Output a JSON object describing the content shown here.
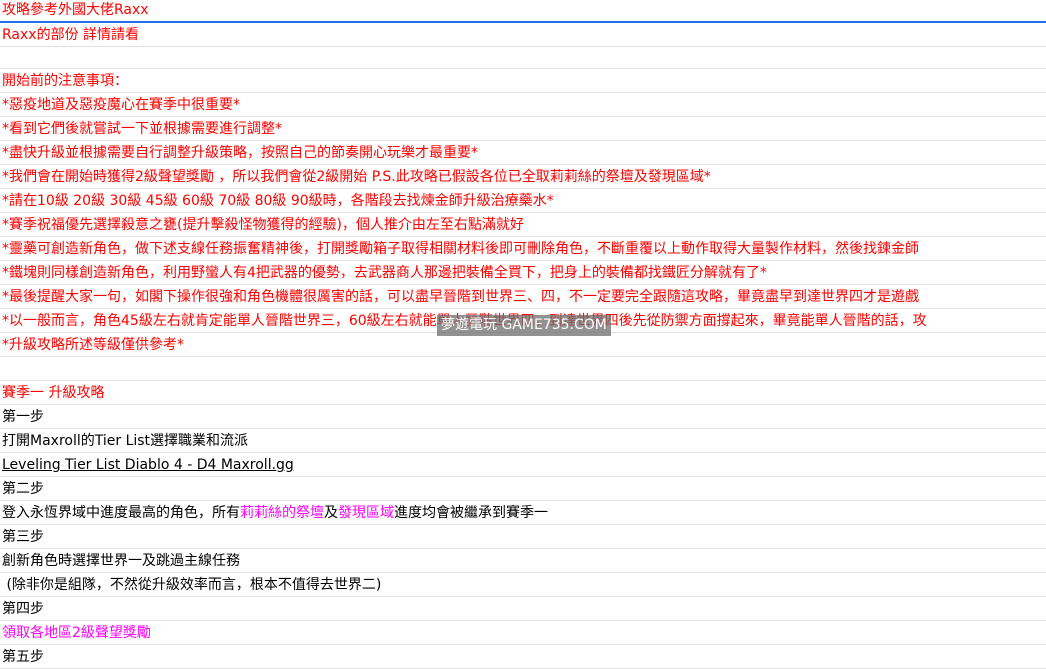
{
  "title": "攻略參考外國大佬Raxx",
  "intro": "Raxx的部份 詳情請看",
  "notes_heading": "開始前的注意事項：",
  "notes": [
    "*惡疫地道及惡疫魔心在賽季中很重要*",
    "*看到它們後就嘗試一下並根據需要進行調整*",
    "*盡快升級並根據需要自行調整升級策略，按照自己的節奏開心玩樂才最重要*",
    "*我們會在開始時獲得2級聲望獎勵 ，所以我們會從2級開始 P.S.此攻略已假設各位已全取莉莉絲的祭壇及發現區域*",
    "*請在10級 20級 30級 45級 60級 70級 80級 90級時，各階段去找煉金師升級治療藥水*",
    "*賽季祝福優先選擇殺意之甕(提升擊殺怪物獲得的經驗)，個人推介由左至右點滿就好",
    "*靈藥可創造新角色，做下述支線任務振奮精神後，打開獎勵箱子取得相關材料後即可刪除角色，不斷重覆以上動作取得大量製作材料，然後找鍊金師",
    "*鐵塊則同樣創造新角色，利用野蠻人有4把武器的優勢，去武器商人那邊把裝備全買下，把身上的裝備都找鐵匠分解就有了*",
    "*最後提醒大家一句，如閣下操作很強和角色機體很厲害的話，可以盡早晉階到世界三、四，不一定要完全跟隨這攻略，畢竟盡早到達世界四才是遊戲",
    "*以一般而言，角色45級左右就肯定能單人晉階世界三，60級左右就能單人晉階世界四，到達世界四後先從防禦方面撐起來，畢竟能單人晉階的話，攻",
    "*升級攻略所述等級僅供參考*"
  ],
  "season_heading": "賽季一 升級攻略",
  "steps": {
    "step1": "第一步",
    "step1_text": "打開Maxroll的Tier List選擇職業和流派",
    "step1_link": "Leveling Tier List Diablo 4 - D4 Maxroll.gg",
    "step2": "第二步",
    "step2_pre": "登入永恆界域中進度最高的角色，所有",
    "step2_hl1": "莉莉絲的祭壇",
    "step2_mid": "及",
    "step2_hl2": "發現區域",
    "step2_post": "進度均會被繼承到賽季一",
    "step3": "第三步",
    "step3_text": "創新角色時選擇世界一及跳過主線任務",
    "step3_note": " (除非你是組隊，不然從升級效率而言，根本不值得去世界二)",
    "step4": "第四步",
    "step4_text": "領取各地區2級聲望獎勵",
    "step5": "第五步"
  },
  "watermark": "夢遊電玩 GAME735.COM"
}
